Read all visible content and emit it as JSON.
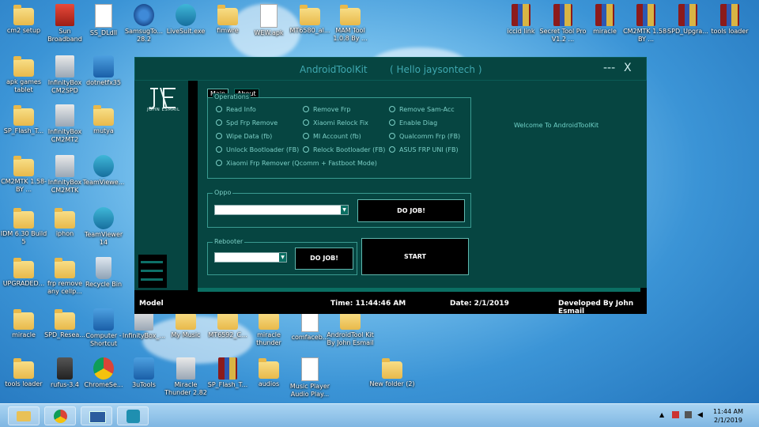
{
  "desktop_icons": [
    {
      "label": "cm2 setup",
      "icon": "folder-icon",
      "type": "folder"
    },
    {
      "label": "Sun Broadband",
      "icon": "sun-broadband-icon",
      "type": "red"
    },
    {
      "label": "SS_DLdll",
      "icon": "settings-file-icon",
      "type": "doc"
    },
    {
      "label": "SamsugTo... 28.2",
      "icon": "gears-icon",
      "type": "gear"
    },
    {
      "label": "LiveSuit.exe",
      "icon": "livesuit-icon",
      "type": "teal"
    },
    {
      "label": "fimwre",
      "icon": "folder-icon",
      "type": "folder"
    },
    {
      "label": "WEW.apk",
      "icon": "file-icon",
      "type": "doc"
    },
    {
      "label": "MT6580_al...",
      "icon": "folder-icon",
      "type": "folder"
    },
    {
      "label": "MAM Tool 1.0.8 By ...",
      "icon": "folder-icon",
      "type": "folder"
    },
    {
      "label": "iccid link",
      "icon": "winrar-icon",
      "type": "rar"
    },
    {
      "label": "Secret Tool Pro V1.2 ...",
      "icon": "winrar-icon",
      "type": "rar"
    },
    {
      "label": "miracle",
      "icon": "winrar-icon",
      "type": "rar"
    },
    {
      "label": "CM2MTK 1.58-BY ...",
      "icon": "winrar-icon",
      "type": "rar"
    },
    {
      "label": "SPD_Upgra...",
      "icon": "winrar-icon",
      "type": "rar"
    },
    {
      "label": "tools loader",
      "icon": "winrar-icon",
      "type": "rar"
    },
    {
      "label": "apk games tablet",
      "icon": "folder-icon",
      "type": "folder"
    },
    {
      "label": "InfinityBox CM2SPD",
      "icon": "infinitybox-icon",
      "type": "box"
    },
    {
      "label": "dotnetfx35",
      "icon": "installer-icon",
      "type": "app"
    },
    {
      "label": "SP_Flash_T...",
      "icon": "folder-icon",
      "type": "folder"
    },
    {
      "label": "InfinityBox CM2MT2",
      "icon": "infinitybox-icon",
      "type": "box"
    },
    {
      "label": "mutya",
      "icon": "folder-icon",
      "type": "folder"
    },
    {
      "label": "CM2MTK 1.58-BY ...",
      "icon": "folder-icon",
      "type": "folder"
    },
    {
      "label": "InfinityBox CM2MTK",
      "icon": "infinitybox-icon",
      "type": "box"
    },
    {
      "label": "TeamViewe...",
      "icon": "teamviewer-icon",
      "type": "teal"
    },
    {
      "label": "IDM 6.30 Build 5",
      "icon": "folder-icon",
      "type": "folder"
    },
    {
      "label": "iphon",
      "icon": "folder-icon",
      "type": "folder"
    },
    {
      "label": "TeamViewer 14",
      "icon": "teamviewer-icon",
      "type": "teal"
    },
    {
      "label": "UPGRADED...",
      "icon": "folder-icon",
      "type": "folder"
    },
    {
      "label": "frp remove any cellp...",
      "icon": "folder-icon",
      "type": "folder"
    },
    {
      "label": "Recycle Bin",
      "icon": "recycle-bin-icon",
      "type": "bin"
    },
    {
      "label": "miracle",
      "icon": "folder-icon",
      "type": "folder"
    },
    {
      "label": "SPD_Resea...",
      "icon": "folder-icon",
      "type": "folder"
    },
    {
      "label": "Computer - Shortcut",
      "icon": "computer-icon",
      "type": "app"
    },
    {
      "label": "InfinityBox_...",
      "icon": "infinitybox-icon",
      "type": "box"
    },
    {
      "label": "My Music",
      "icon": "folder-icon",
      "type": "folder"
    },
    {
      "label": "MT6592_C...",
      "icon": "folder-icon",
      "type": "folder"
    },
    {
      "label": "miracle thunder",
      "icon": "folder-icon",
      "type": "folder"
    },
    {
      "label": "comfaceb...",
      "icon": "file-icon",
      "type": "doc"
    },
    {
      "label": "AndroidTool Kit By John Esmail",
      "icon": "folder-icon",
      "type": "folder"
    },
    {
      "label": "tools loader",
      "icon": "folder-icon",
      "type": "folder"
    },
    {
      "label": "rufus-3.4",
      "icon": "usb-drive-icon",
      "type": "usb"
    },
    {
      "label": "ChromeSe...",
      "icon": "chrome-setup-icon",
      "type": "chrome"
    },
    {
      "label": "3uTools",
      "icon": "3utools-icon",
      "type": "app"
    },
    {
      "label": "Miracle Thunder 2.82",
      "icon": "miracle-thunder-icon",
      "type": "box"
    },
    {
      "label": "SP_Flash_T...",
      "icon": "winrar-icon",
      "type": "rar"
    },
    {
      "label": "audios",
      "icon": "folder-icon",
      "type": "folder"
    },
    {
      "label": "Music Player Audio Play...",
      "icon": "file-icon",
      "type": "doc"
    },
    {
      "label": "New folder (2)",
      "icon": "folder-icon",
      "type": "folder"
    }
  ],
  "app": {
    "title": "AndroidToolKit",
    "greeting": "( Hello jaysontech )",
    "minimize_label": "---",
    "close_label": "X",
    "logo_text": "JOHN ESMAIL",
    "tabs": [
      {
        "label": "Main"
      },
      {
        "label": "About"
      }
    ],
    "welcome": "Welcome To AndroidToolKit",
    "operations": {
      "label": "Operations",
      "options": [
        "Read Info",
        "Remove Frp",
        "Remove Sam-Acc",
        "Spd Frp Remove",
        "Xiaomi Relock Fix",
        "Enable Diag",
        "Wipe Data (fb)",
        "MI Account (fb)",
        "Qualcomm Frp (FB)",
        "Unlock Bootloader (FB)",
        "Relock Bootloader (FB)",
        "ASUS FRP UNI (FB)",
        "Xiaomi Frp Remover (Qcomm + Fastboot Mode)"
      ]
    },
    "oppo": {
      "label": "Oppo",
      "button": "DO JOB!",
      "combo_arrow": "▼"
    },
    "rebooter": {
      "label": "Rebooter",
      "button": "DO JOB!",
      "combo_arrow": "▼"
    },
    "start_button": "START",
    "status": {
      "model": "Model",
      "time": "Time: 11:44:46 AM",
      "date": "Date: 2/1/2019",
      "developer": "Developed By John Esmail"
    }
  },
  "taskbar": {
    "items": [
      {
        "name": "file-explorer-icon"
      },
      {
        "name": "chrome-icon"
      },
      {
        "name": "computer-graph-icon"
      },
      {
        "name": "tools-icon"
      }
    ],
    "tray": [
      "show-hidden-icons-arrow",
      "flag-icon",
      "network-icon",
      "volume-icon"
    ],
    "time": "11:44 AM",
    "date": "2/1/2019"
  },
  "colors": {
    "window_bg": "#064541",
    "accent": "#7ccfc6",
    "desktop": "#3b94d6"
  }
}
